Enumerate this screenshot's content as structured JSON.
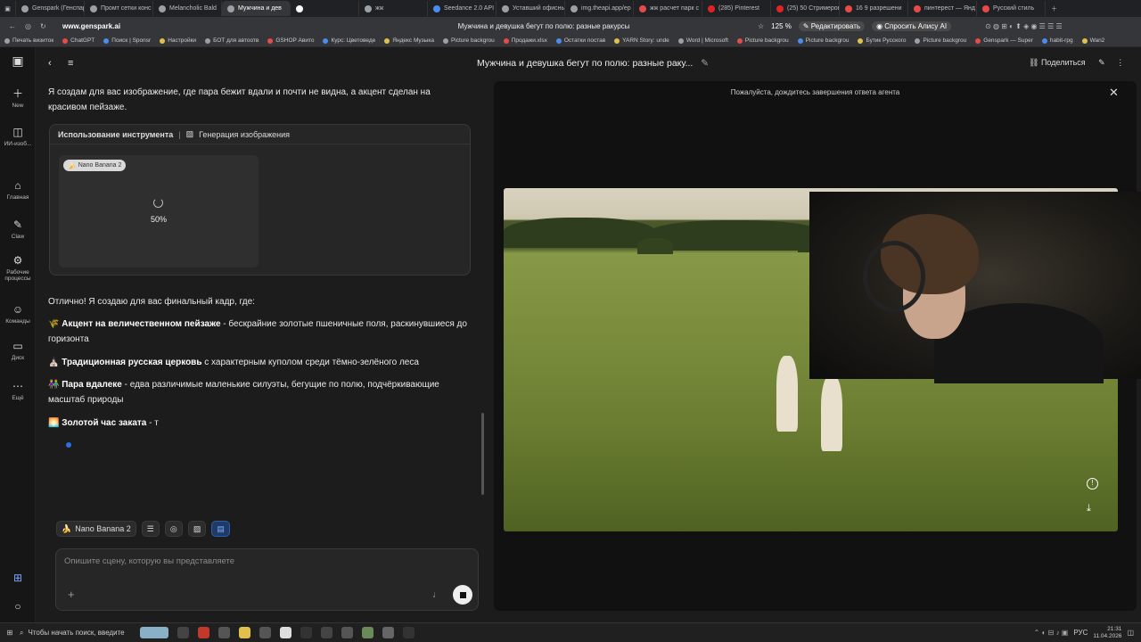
{
  "browser": {
    "tabs": [
      {
        "label": "Genspark (Генспар",
        "color": "#9aa0a6"
      },
      {
        "label": "Промт сетки конс",
        "color": "#9aa0a6"
      },
      {
        "label": "Melancholic Bald",
        "color": "#9aa0a6"
      },
      {
        "label": "Мужчина и дев",
        "color": "#9aa0a6",
        "active": true
      },
      {
        "label": "",
        "color": "#ffffff"
      },
      {
        "label": "жж",
        "color": "#9aa0a6"
      },
      {
        "label": "Seedance 2.0 API",
        "color": "#4a8cf0"
      },
      {
        "label": "Уставший офисны",
        "color": "#9aa0a6"
      },
      {
        "label": "img.theapi.app/ep",
        "color": "#9aa0a6"
      },
      {
        "label": "жж расчет парк с",
        "color": "#e84a4a"
      },
      {
        "label": "(285) Pinterest",
        "color": "#e02424"
      },
      {
        "label": "(25) 50 Стримеров",
        "color": "#e02424"
      },
      {
        "label": "16 9 разрешени",
        "color": "#e84a4a"
      },
      {
        "label": "пинтерест — Янд",
        "color": "#e84a4a"
      },
      {
        "label": "Русский стиль",
        "color": "#e84a4a"
      }
    ],
    "url": "www.genspark.ai",
    "page_title": "Мужчина и девушка бегут по полю: разные ракурсы",
    "zoom": "125 %",
    "edit_label": "Редактировать",
    "alice_label": "Спросить Алису AI",
    "bookmarks": [
      "Печать визиток",
      "ChatGPT",
      "Поиск | Sponsr",
      "Настройки",
      "БОТ для автоотв",
      "GSHOP Авито",
      "Курс: Цветоведе",
      "Яндекс Музыка",
      "Picture backgrou",
      "Продажи.xlsx",
      "Остатки постав",
      "YARN Story: unde",
      "Word | Microsoft",
      "Picture backgrou",
      "Picture backgrou",
      "Бутик Русского",
      "Picture backgrou",
      "Genspark — Super",
      "habit-rpg",
      "Wan2"
    ]
  },
  "rail": [
    {
      "label": "New",
      "icon": "＋"
    },
    {
      "label": "ИИ-изоб...",
      "icon": "◫"
    },
    {
      "label": "Главная",
      "icon": "⌂"
    },
    {
      "label": "Claw",
      "icon": "✎"
    },
    {
      "label": "Рабочие процессы",
      "icon": "⚙"
    },
    {
      "label": "Команды",
      "icon": "☺"
    },
    {
      "label": "Диск",
      "icon": "▭"
    },
    {
      "label": "Ещё",
      "icon": "⋯"
    }
  ],
  "chat": {
    "intro": "Я создам для вас изображение, где пара бежит вдали и почти не видна, а акцент сделан на красивом пейзаже.",
    "tool_use_label": "Использование инструмента",
    "tool_name": "Генерация изображения",
    "model_tag": "Nano Banana 2",
    "progress_text": "50%",
    "progress_value": 0.5,
    "final_intro": "Отлично! Я создаю для вас финальный кадр, где:",
    "points": [
      {
        "emoji": "🌾",
        "title": "Акцент на величественном пейзаже",
        "text": " - бескрайние золотые пшеничные поля, раскинувшиеся до горизонта"
      },
      {
        "emoji": "⛪",
        "title": "Традиционная русская церковь",
        "text": " с характерным куполом среди тёмно-зелёного леса"
      },
      {
        "emoji": "👫",
        "title": "Пара вдалеке",
        "text": " - едва различимые маленькие силуэты, бегущие по полю, подчёркивающие масштаб природы"
      },
      {
        "emoji": "🌅",
        "title": "Золотой час заката",
        "text": " - т"
      }
    ],
    "toolbar_model": "Nano Banana 2",
    "input_placeholder": "Опишите сцену, которую вы представляете"
  },
  "right": {
    "title": "Мужчина и девушка бегут по полю: разные раку...",
    "share_label": "Поделиться",
    "notice": "Пожалуйста, дождитесь завершения ответа агента"
  },
  "taskbar": {
    "search_placeholder": "Чтобы начать поиск, введите",
    "lang": "РУС",
    "time": "21:31",
    "date": "11.04.2026"
  },
  "colors": {
    "accent": "#2d6fe0",
    "panel": "#262626",
    "bg": "#1c1c1c"
  }
}
